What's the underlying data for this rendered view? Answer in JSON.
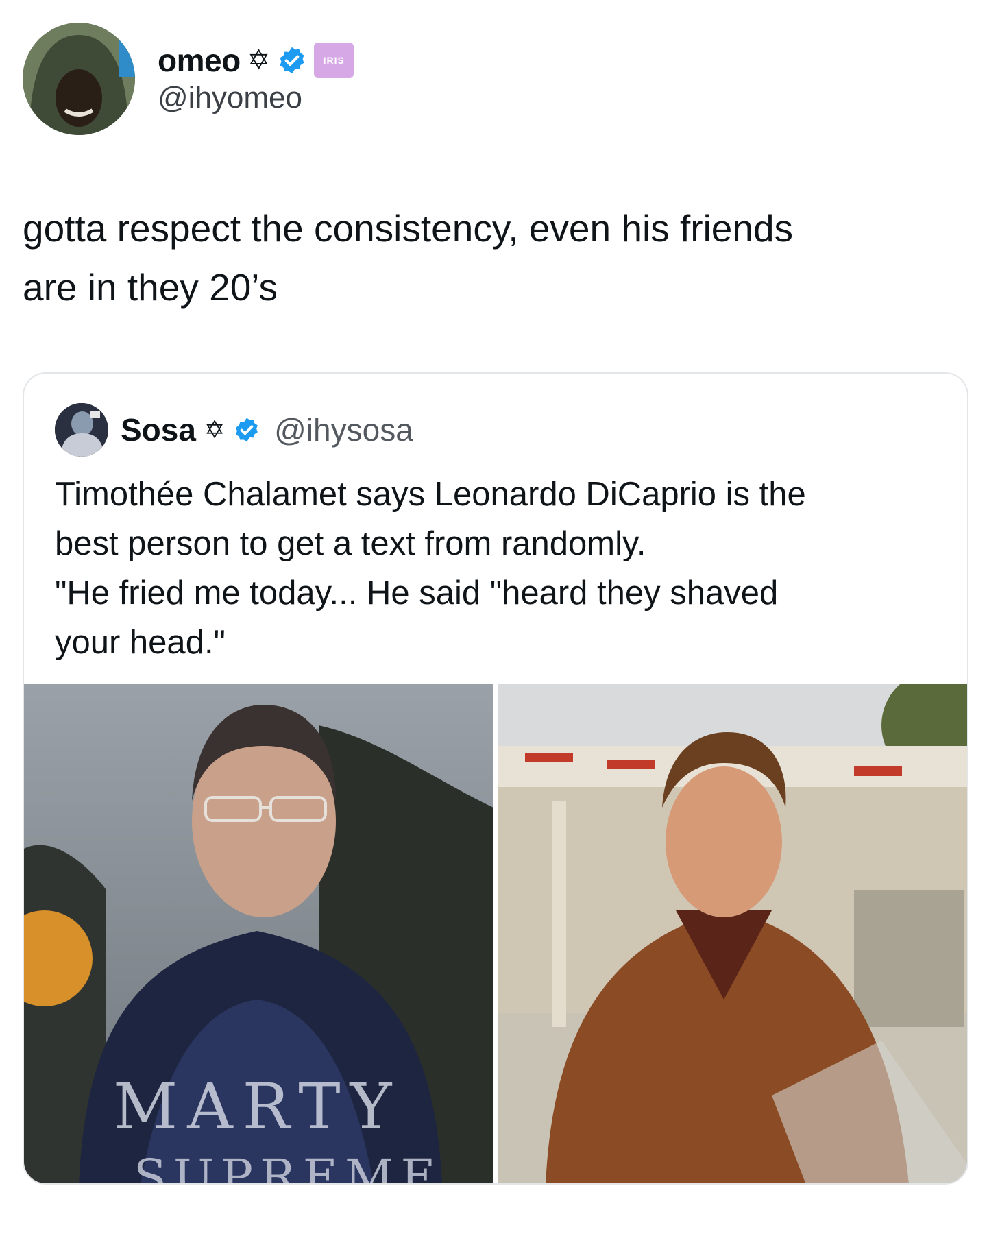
{
  "author": {
    "display_name": "omeo",
    "symbol": "✡",
    "handle": "@ihyomeo",
    "badge_label": "IRIS"
  },
  "tweet": {
    "line1": "gotta respect the consistency, even his friends",
    "line2": "are in they 20’s"
  },
  "quoted": {
    "display_name": "Sosa",
    "symbol": "✡",
    "handle": "@ihysosa",
    "lines": [
      "Timothée Chalamet says Leonardo DiCaprio is the",
      "best person to get a text from randomly.",
      "\"He fried me today... He said \"heard they shaved",
      "your head.\""
    ],
    "photo_left_shirt_line1": "MARTY",
    "photo_left_shirt_line2": "SUPREME"
  },
  "colors": {
    "verified": "#1d9bf0",
    "iris_badge": "#d6a8e6",
    "border": "#e3e6e9"
  },
  "icons": [
    "verified-badge-icon",
    "iris-badge-icon"
  ]
}
